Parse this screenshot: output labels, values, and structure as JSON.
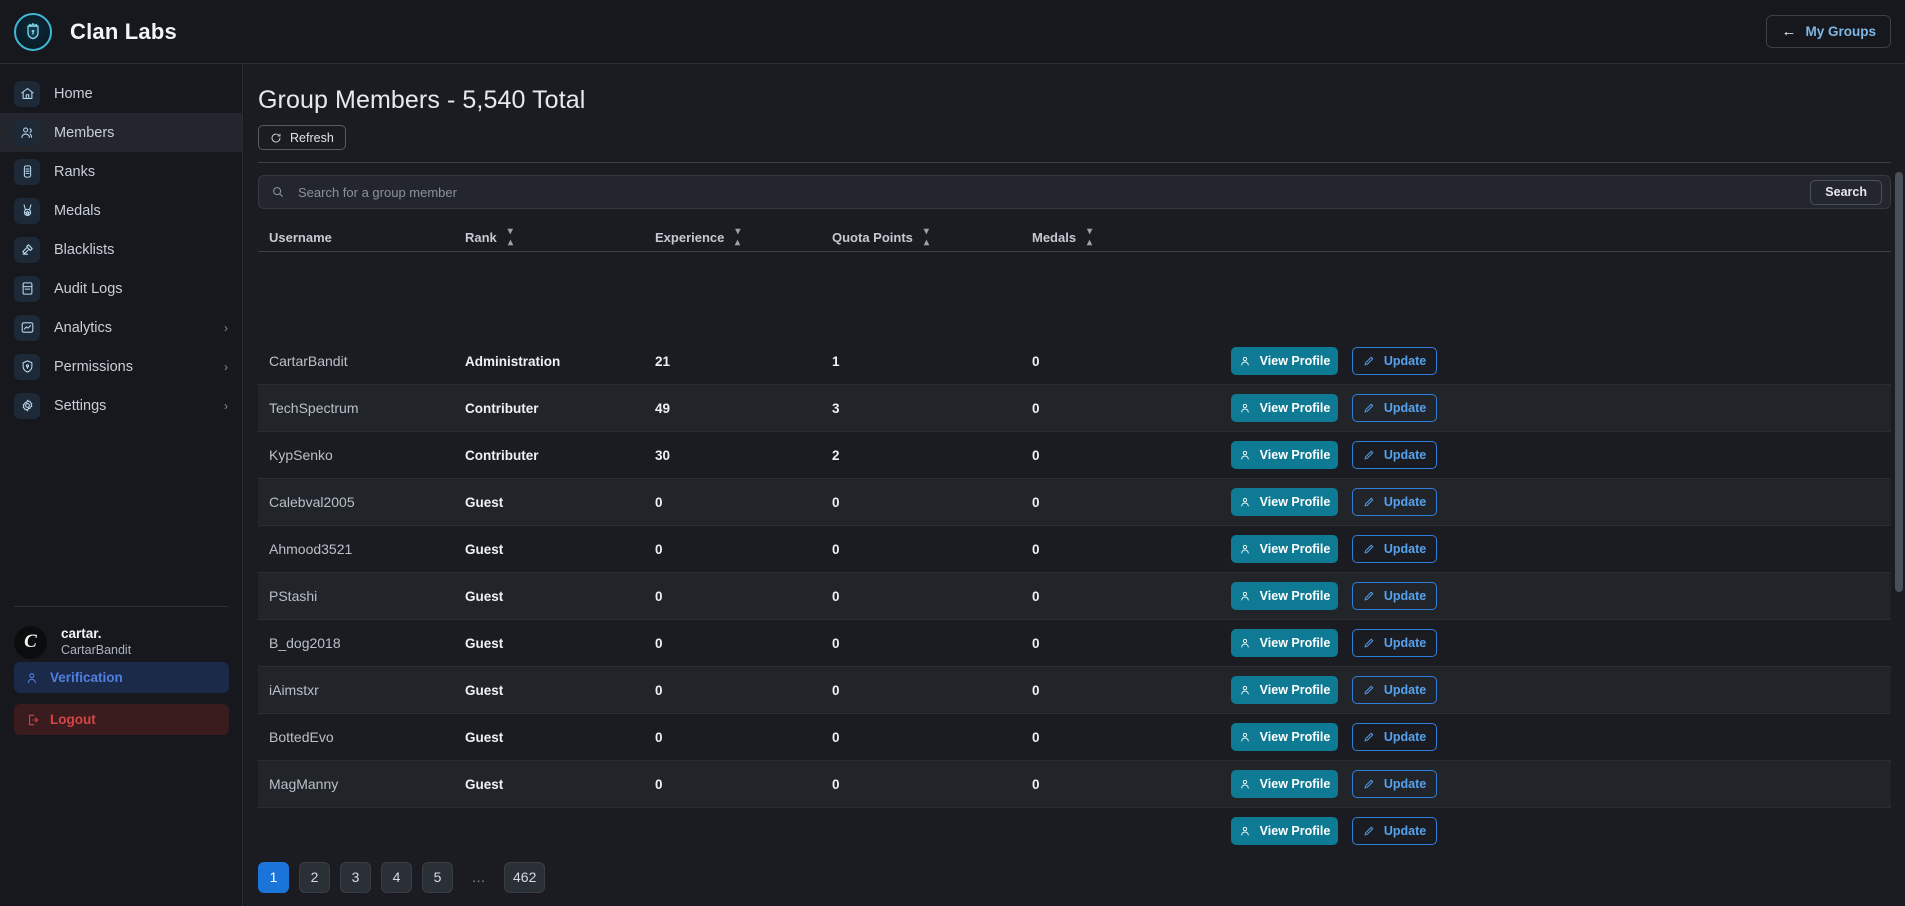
{
  "app": {
    "brand_name": "Clan Labs",
    "logo_icon": "shield-crown-icon",
    "accent_color": "#0e7a94",
    "primary_blue": "#1a74d9"
  },
  "topbar": {
    "my_groups_label": "My Groups",
    "my_groups_arrow": "←",
    "back-arrow-icon": "arrow-left-icon"
  },
  "sidebar": {
    "items": [
      {
        "label": "Home",
        "icon": "home-icon",
        "active": false,
        "chevron": ""
      },
      {
        "label": "Members",
        "icon": "users-icon",
        "active": true,
        "chevron": ""
      },
      {
        "label": "Ranks",
        "icon": "rank-icon",
        "active": false,
        "chevron": ""
      },
      {
        "label": "Medals",
        "icon": "medal-icon",
        "active": false,
        "chevron": ""
      },
      {
        "label": "Blacklists",
        "icon": "gavel-icon",
        "active": false,
        "chevron": ""
      },
      {
        "label": "Audit Logs",
        "icon": "book-icon",
        "active": false,
        "chevron": ""
      },
      {
        "label": "Analytics",
        "icon": "chart-icon",
        "active": false,
        "chevron": "›"
      },
      {
        "label": "Permissions",
        "icon": "shield-lock-icon",
        "active": false,
        "chevron": "›"
      },
      {
        "label": "Settings",
        "icon": "gear-icon",
        "active": false,
        "chevron": "›"
      }
    ],
    "user": {
      "avatar_letter": "C",
      "display_name": "cartar.",
      "handle": "CartarBandit"
    },
    "verification_label": "Verification",
    "verification_icon": "user-check-icon",
    "logout_label": "Logout",
    "logout_icon": "logout-icon"
  },
  "main": {
    "page_title": "Group Members - 5,540 Total",
    "refresh_label": "Refresh",
    "refresh_icon": "refresh-icon",
    "search": {
      "placeholder": "Search for a group member",
      "value": "",
      "icon": "search-icon",
      "button_label": "Search"
    },
    "table": {
      "columns": [
        {
          "label": "Username",
          "sortable": false
        },
        {
          "label": "Rank",
          "sortable": true
        },
        {
          "label": "Experience",
          "sortable": true
        },
        {
          "label": "Quota Points",
          "sortable": true
        },
        {
          "label": "Medals",
          "sortable": true
        }
      ],
      "sort_glyph": "⇅",
      "actions": {
        "view_label": "View Profile",
        "view_icon": "user-icon",
        "update_label": "Update",
        "update_icon": "pencil-icon"
      },
      "rows": [
        {
          "username": "CartarBandit",
          "rank": "Administration",
          "experience": "21",
          "quota": "1",
          "medals": "0"
        },
        {
          "username": "TechSpectrum",
          "rank": "Contributer",
          "experience": "49",
          "quota": "3",
          "medals": "0"
        },
        {
          "username": "KypSenko",
          "rank": "Contributer",
          "experience": "30",
          "quota": "2",
          "medals": "0"
        },
        {
          "username": "Calebval2005",
          "rank": "Guest",
          "experience": "0",
          "quota": "0",
          "medals": "0"
        },
        {
          "username": "Ahmood3521",
          "rank": "Guest",
          "experience": "0",
          "quota": "0",
          "medals": "0"
        },
        {
          "username": "PStashi",
          "rank": "Guest",
          "experience": "0",
          "quota": "0",
          "medals": "0"
        },
        {
          "username": "B_dog2018",
          "rank": "Guest",
          "experience": "0",
          "quota": "0",
          "medals": "0"
        },
        {
          "username": "iAimstxr",
          "rank": "Guest",
          "experience": "0",
          "quota": "0",
          "medals": "0"
        },
        {
          "username": "BottedEvo",
          "rank": "Guest",
          "experience": "0",
          "quota": "0",
          "medals": "0"
        },
        {
          "username": "MagManny",
          "rank": "Guest",
          "experience": "0",
          "quota": "0",
          "medals": "0"
        },
        {
          "username": "",
          "rank": "",
          "experience": "",
          "quota": "",
          "medals": ""
        }
      ]
    },
    "pagination": {
      "pages": [
        "1",
        "2",
        "3",
        "4",
        "5",
        "…",
        "462"
      ],
      "current": "1"
    }
  }
}
